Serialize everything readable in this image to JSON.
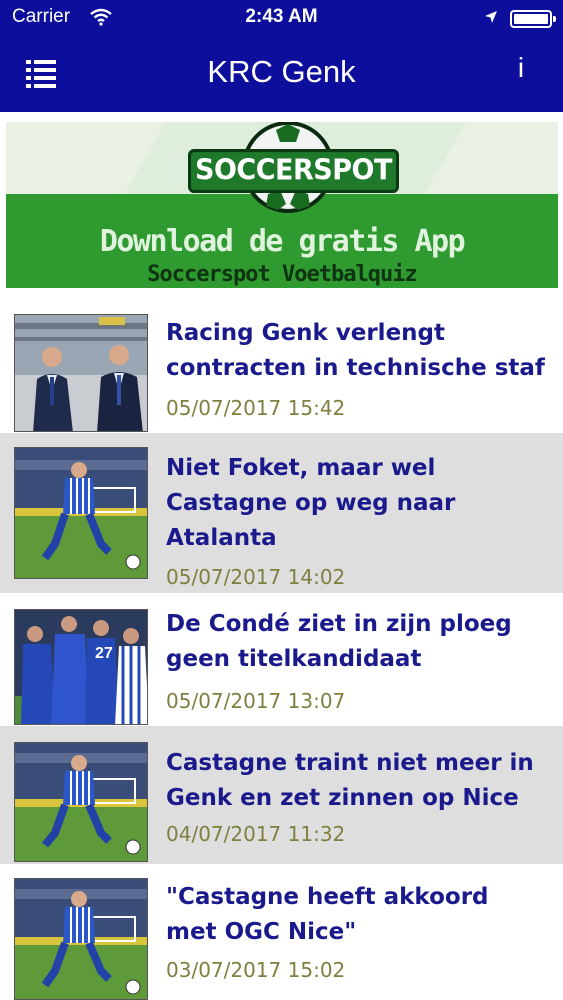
{
  "status_bar": {
    "carrier": "Carrier",
    "time": "2:43 AM"
  },
  "navbar": {
    "title": "KRC Genk",
    "info_label": "i",
    "color": "#0d0f9c"
  },
  "banner": {
    "logo_text": "SOCCERSPOT",
    "headline": "Download de gratis App",
    "subline": "Soccerspot Voetbalquiz"
  },
  "news": [
    {
      "headline": "Racing Genk verlengt contracten in technische staf",
      "date": "05/07/2017 15:42",
      "thumb": "two-men-in-suits-photo"
    },
    {
      "headline": "Niet Foket, maar wel Castagne op weg naar Atalanta",
      "date": "05/07/2017 14:02",
      "thumb": "player-with-ball-photo"
    },
    {
      "headline": "De Condé ziet in zijn ploeg geen titelkandidaat",
      "date": "05/07/2017 13:07",
      "thumb": "team-celebration-photo"
    },
    {
      "headline": "Castagne traint niet meer in Genk en zet zinnen op Nice",
      "date": "04/07/2017 11:32",
      "thumb": "player-with-ball-photo"
    },
    {
      "headline": "\"Castagne heeft akkoord met OGC Nice\"",
      "date": "03/07/2017 15:02",
      "thumb": "player-with-ball-photo"
    }
  ]
}
